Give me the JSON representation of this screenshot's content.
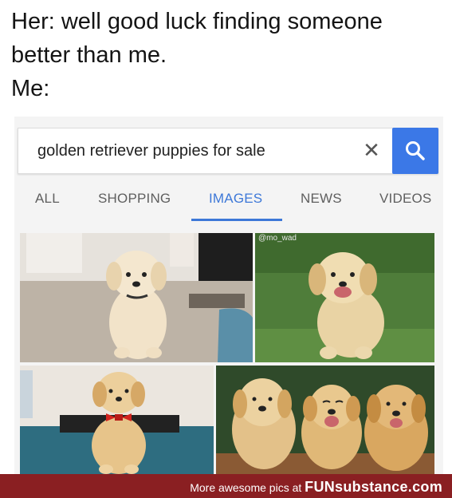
{
  "caption": {
    "line1": "Her: well good luck finding someone",
    "line2": "better than me.",
    "line3": "Me:"
  },
  "search": {
    "query": "golden retriever puppies for sale",
    "clear_icon": "close-icon",
    "search_icon": "magnifier-icon",
    "accent_color": "#3b78e7"
  },
  "tabs": [
    {
      "label": "ALL",
      "active": false
    },
    {
      "label": "SHOPPING",
      "active": false
    },
    {
      "label": "IMAGES",
      "active": true
    },
    {
      "label": "NEWS",
      "active": false
    },
    {
      "label": "VIDEOS",
      "active": false
    }
  ],
  "results": {
    "watermark": "@mo_wad"
  },
  "footer": {
    "text": "More awesome pics at",
    "brand": "FUNsubstance.com",
    "background": "#8a1f22"
  }
}
